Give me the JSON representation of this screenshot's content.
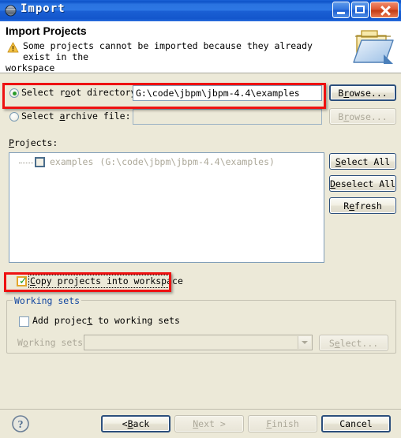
{
  "window": {
    "title": "Import",
    "icon": "sphere-icon",
    "minimize_label": "Minimize",
    "maximize_label": "Maximize",
    "close_label": "Close"
  },
  "header": {
    "title": "Import Projects",
    "warning_icon": "warning-triangle-icon",
    "message_line1": "Some projects cannot be imported because they already exist in the",
    "message_line2": "workspace",
    "banner_icon": "open-folder-icon"
  },
  "source": {
    "root_directory": {
      "label_pre": "Select r",
      "label_mnemonic": "o",
      "label_post": "ot directory:",
      "selected": true,
      "value": "G:\\code\\jbpm\\jbpm-4.4\\examples",
      "browse_pre": "B",
      "browse_mnemonic": "r",
      "browse_post": "owse..."
    },
    "archive_file": {
      "label_pre": "Select ",
      "label_mnemonic": "a",
      "label_post": "rchive file:",
      "selected": false,
      "value": "",
      "browse_pre": "B",
      "browse_mnemonic": "r",
      "browse_post": "owse..."
    }
  },
  "projects": {
    "label_mnemonic": "P",
    "label_post": "rojects:",
    "items": [
      {
        "name": "examples",
        "path": "(G:\\code\\jbpm\\jbpm-4.4\\examples)",
        "checked": false,
        "enabled": false
      }
    ],
    "buttons": {
      "select_all_pre": "",
      "select_all_mnemonic": "S",
      "select_all_post": "elect All",
      "deselect_all_pre": "",
      "deselect_all_mnemonic": "D",
      "deselect_all_post": "eselect All",
      "refresh_pre": "R",
      "refresh_mnemonic": "e",
      "refresh_post": "fresh"
    }
  },
  "options": {
    "copy_projects": {
      "label_pre": "",
      "label_mnemonic": "C",
      "label_post": "opy projects into workspace",
      "checked": true,
      "focused": true
    }
  },
  "working_sets": {
    "group_title": "Working sets",
    "add_project": {
      "label_pre": "Add projec",
      "label_mnemonic": "t",
      "label_post": " to working sets",
      "checked": false
    },
    "combo_label_pre": "W",
    "combo_label_mnemonic": "o",
    "combo_label_post": "rking sets:",
    "combo_value": "",
    "select_pre": "S",
    "select_mnemonic": "e",
    "select_post": "lect...",
    "enabled": false
  },
  "footer": {
    "help_icon": "help-question-icon",
    "back_pre": "< ",
    "back_mnemonic": "B",
    "back_post": "ack",
    "next_pre": "",
    "next_mnemonic": "N",
    "next_post": "ext >",
    "finish_pre": "",
    "finish_mnemonic": "F",
    "finish_post": "inish",
    "cancel_label": "Cancel"
  },
  "annotations": {
    "highlight_1": "red-rectangle-root-directory",
    "highlight_2": "red-rectangle-copy-projects"
  },
  "colors": {
    "titlebar_blue": "#1b62d8",
    "dialog_bg": "#ECE9D8",
    "annotation_red": "#ee1111",
    "group_title_blue": "#1246a0",
    "disabled_text": "#aca899"
  }
}
